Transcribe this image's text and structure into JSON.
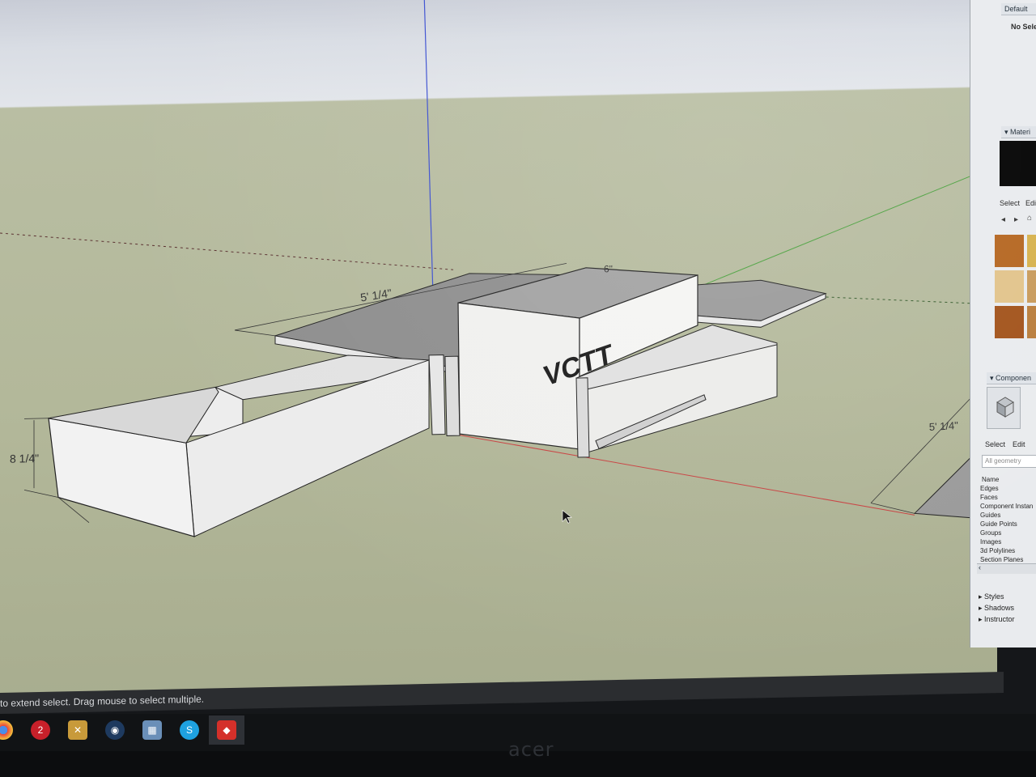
{
  "window": {
    "default_tray_title": "Default",
    "selection_info": "No Sele"
  },
  "materials": {
    "panel_title": "Materi",
    "tabs": [
      "Select",
      "Edi"
    ],
    "swatch_colors": [
      "#b4651f",
      "#d6b14c",
      "#e2c38a",
      "#c89a5a",
      "#a2521a",
      "#b97d3b"
    ],
    "preview_color": "#000000"
  },
  "components": {
    "panel_title": "Componen",
    "tabs": [
      "Select",
      "Edit"
    ],
    "search_placeholder": "All geometry",
    "list_header": "Name",
    "items": [
      "Edges",
      "Faces",
      "Component Instan",
      "Guides",
      "Guide Points",
      "Groups",
      "Images",
      "3d Polylines",
      "Section Planes"
    ]
  },
  "collapsed_panels": [
    "Styles",
    "Shadows",
    "Instructor"
  ],
  "dimensions": {
    "width_label": "5' 1/4\"",
    "height_label": "8 1/4\"",
    "right_label": "5' 1/4\"",
    "partial_label": "6\""
  },
  "model_text": "VCTT",
  "status_bar": {
    "hint": "to extend select. Drag mouse to select multiple."
  },
  "taskbar": {
    "icons": [
      "chrome-icon",
      "game-icon",
      "tool-icon",
      "steam-icon",
      "gallery-icon",
      "skype-icon",
      "sketchup-icon"
    ]
  },
  "monitor": {
    "brand": "acer"
  }
}
